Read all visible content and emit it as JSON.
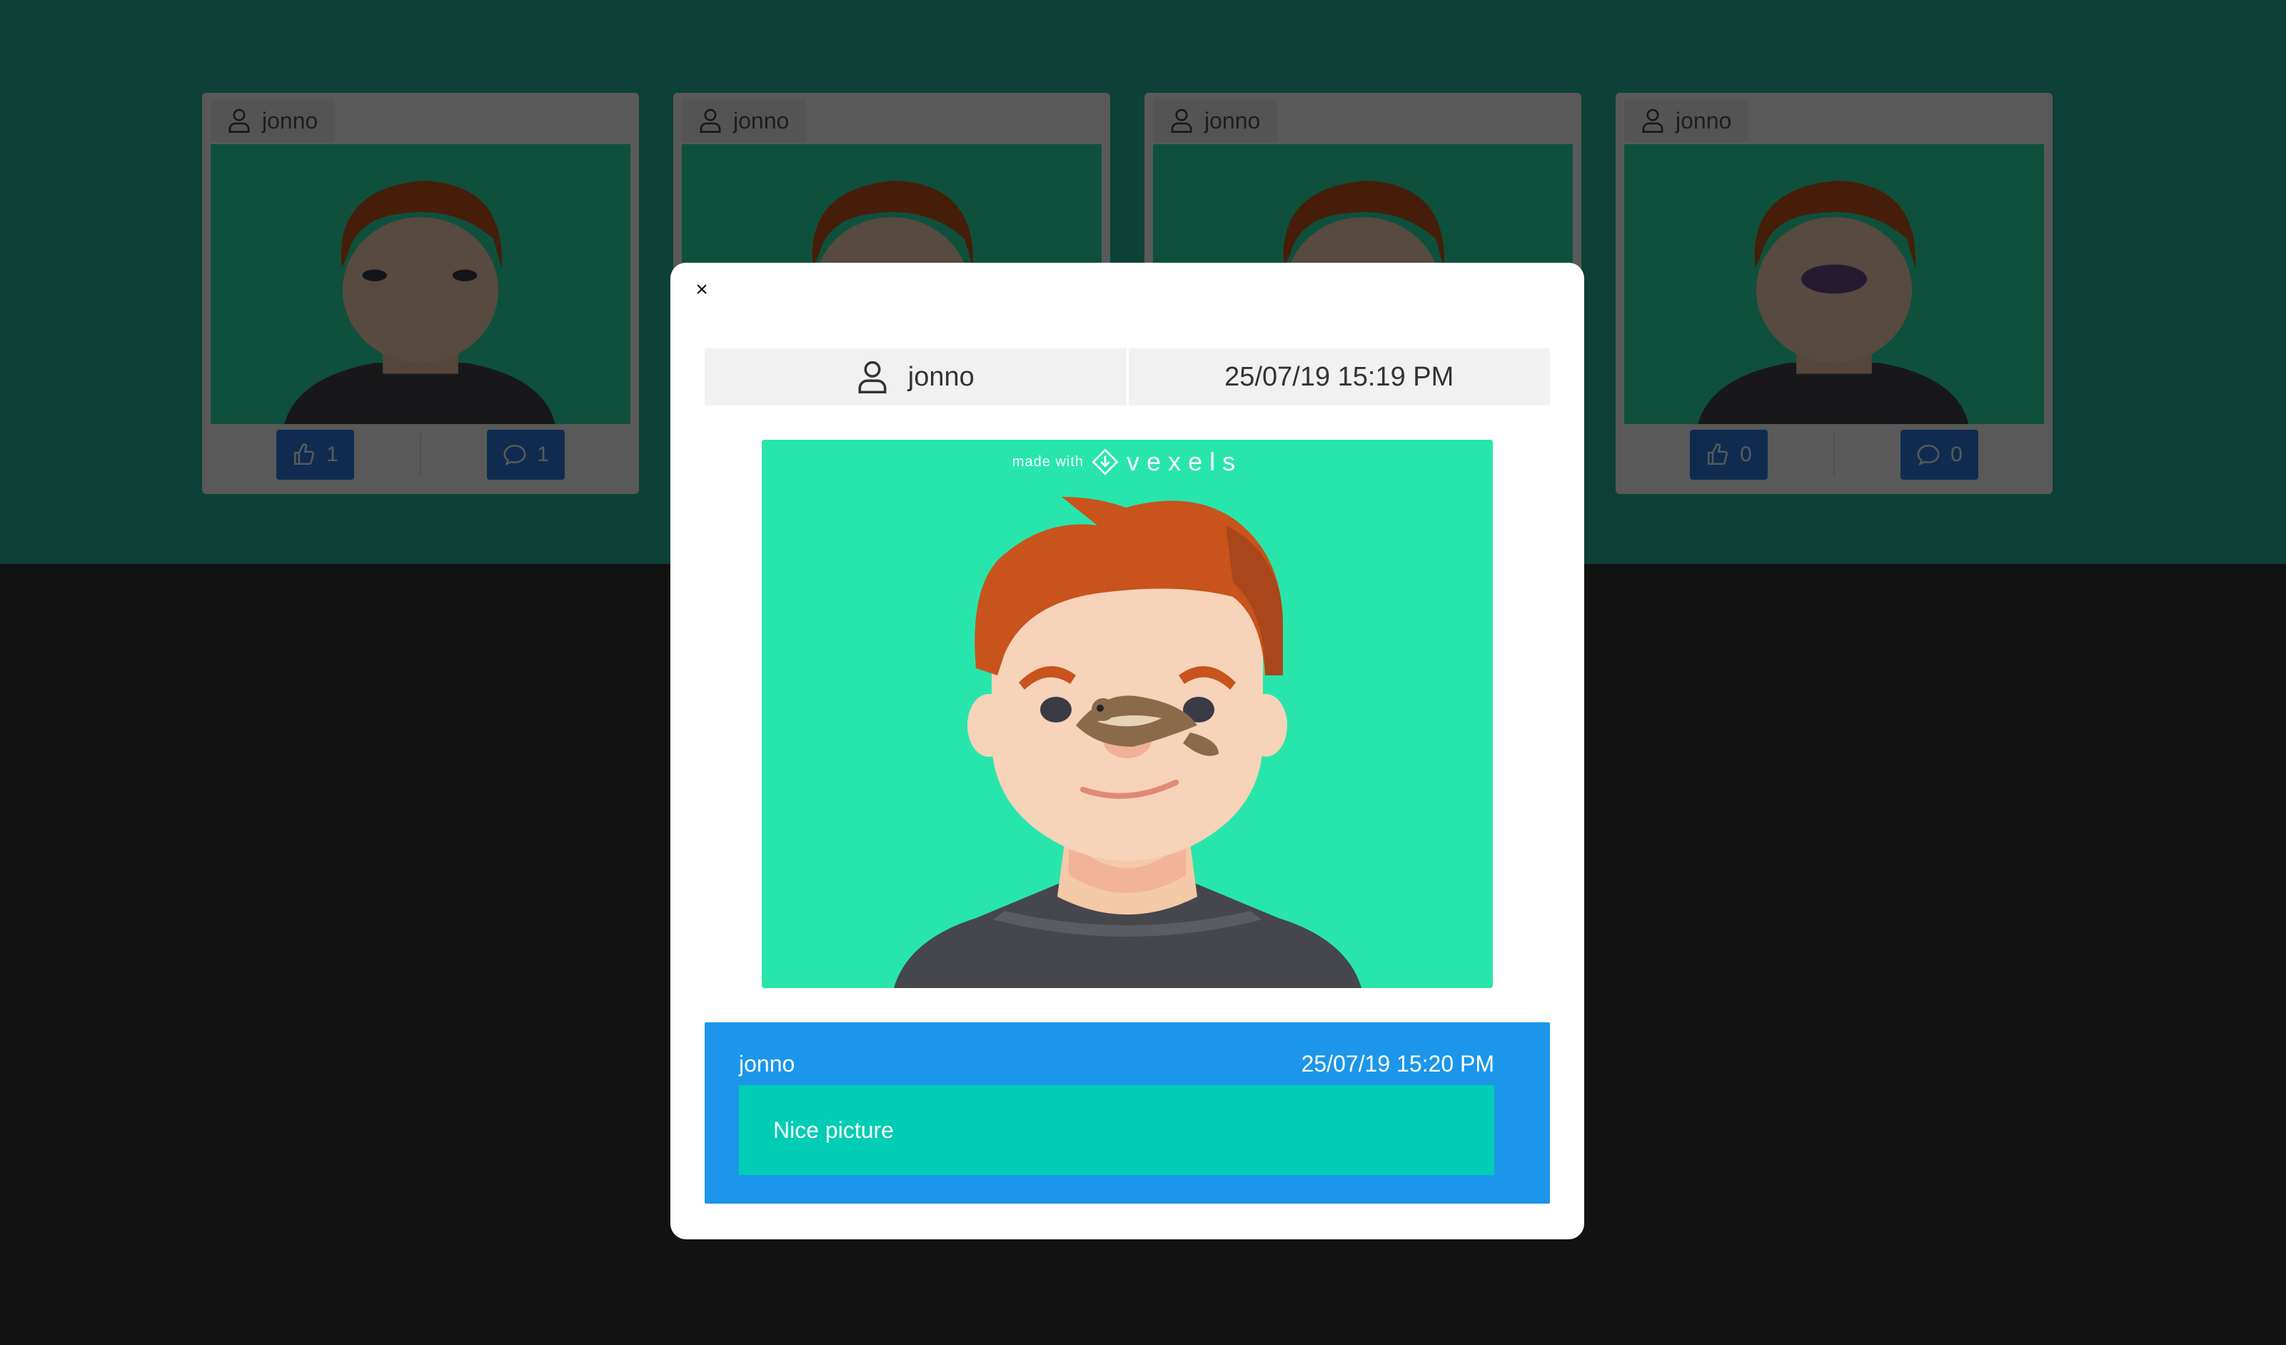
{
  "feed": {
    "cards": [
      {
        "username": "jonno",
        "likes": "1",
        "comments": "1"
      },
      {
        "username": "jonno",
        "likes": "",
        "comments": ""
      },
      {
        "username": "jonno",
        "likes": "",
        "comments": ""
      },
      {
        "username": "jonno",
        "likes": "0",
        "comments": "0"
      }
    ]
  },
  "modal": {
    "close_label": "×",
    "username": "jonno",
    "timestamp": "25/07/19 15:19 PM",
    "image": {
      "watermark_small": "made with",
      "watermark_brand": "vexels"
    },
    "comments": [
      {
        "author": "jonno",
        "timestamp": "25/07/19 15:20 PM",
        "text": "Nice picture"
      }
    ]
  },
  "colors": {
    "background_band": "#25b89c",
    "background_dark": "#343434",
    "image_bg": "#28e6ab",
    "comment_box": "#1c96ea",
    "comment_body": "#00cdb4",
    "button": "#2d7fe6"
  },
  "icons": {
    "user": "user-icon",
    "like": "thumbs-up-icon",
    "comment": "comment-bubble-icon",
    "close": "close-icon"
  }
}
